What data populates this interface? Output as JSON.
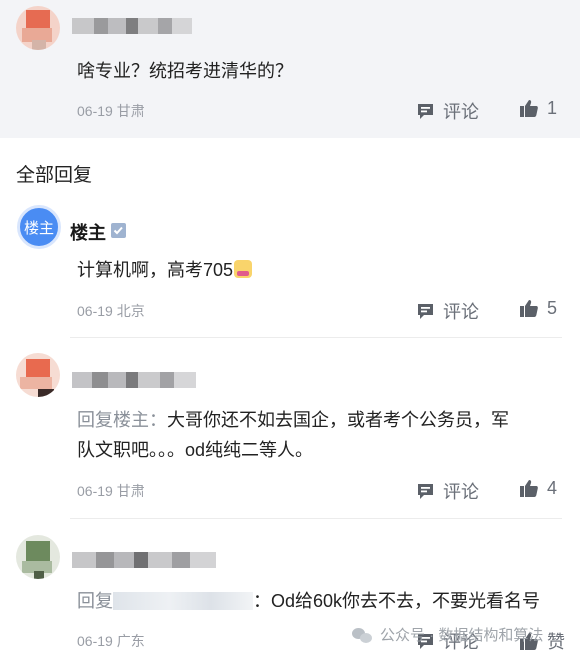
{
  "top_comment": {
    "text": "啥专业？统招考进清华的？",
    "date": "06-19",
    "location": "甘肃",
    "comment_label": "评论",
    "like_count": "1"
  },
  "section_title": "全部回复",
  "replies": [
    {
      "author": "楼主",
      "avatar_text": "楼主",
      "text_prefix": "",
      "text": "计算机啊，高考705",
      "date": "06-19",
      "location": "北京",
      "comment_label": "评论",
      "like_count": "5"
    },
    {
      "text_prefix": "回复楼主：",
      "text_line1": "大哥你还不如去国企，或者考个公务员，军",
      "text_line2": "队文职吧。。。od纯纯二等人。",
      "date": "06-19",
      "location": "甘肃",
      "comment_label": "评论",
      "like_count": "4"
    },
    {
      "text_prefix": "回复",
      "text": "：Od给60k你去不去，不要光看名号",
      "date": "06-19",
      "location": "广东",
      "comment_label": "评论",
      "like_label": "赞"
    }
  ],
  "watermark": "公众号 · 数据结构和算法",
  "colors": {
    "top_block_bg": "#f3f4f7",
    "louzhu_avatar": "#4a8cf3",
    "meta_text": "#999da5",
    "action_text": "#6b7079"
  }
}
